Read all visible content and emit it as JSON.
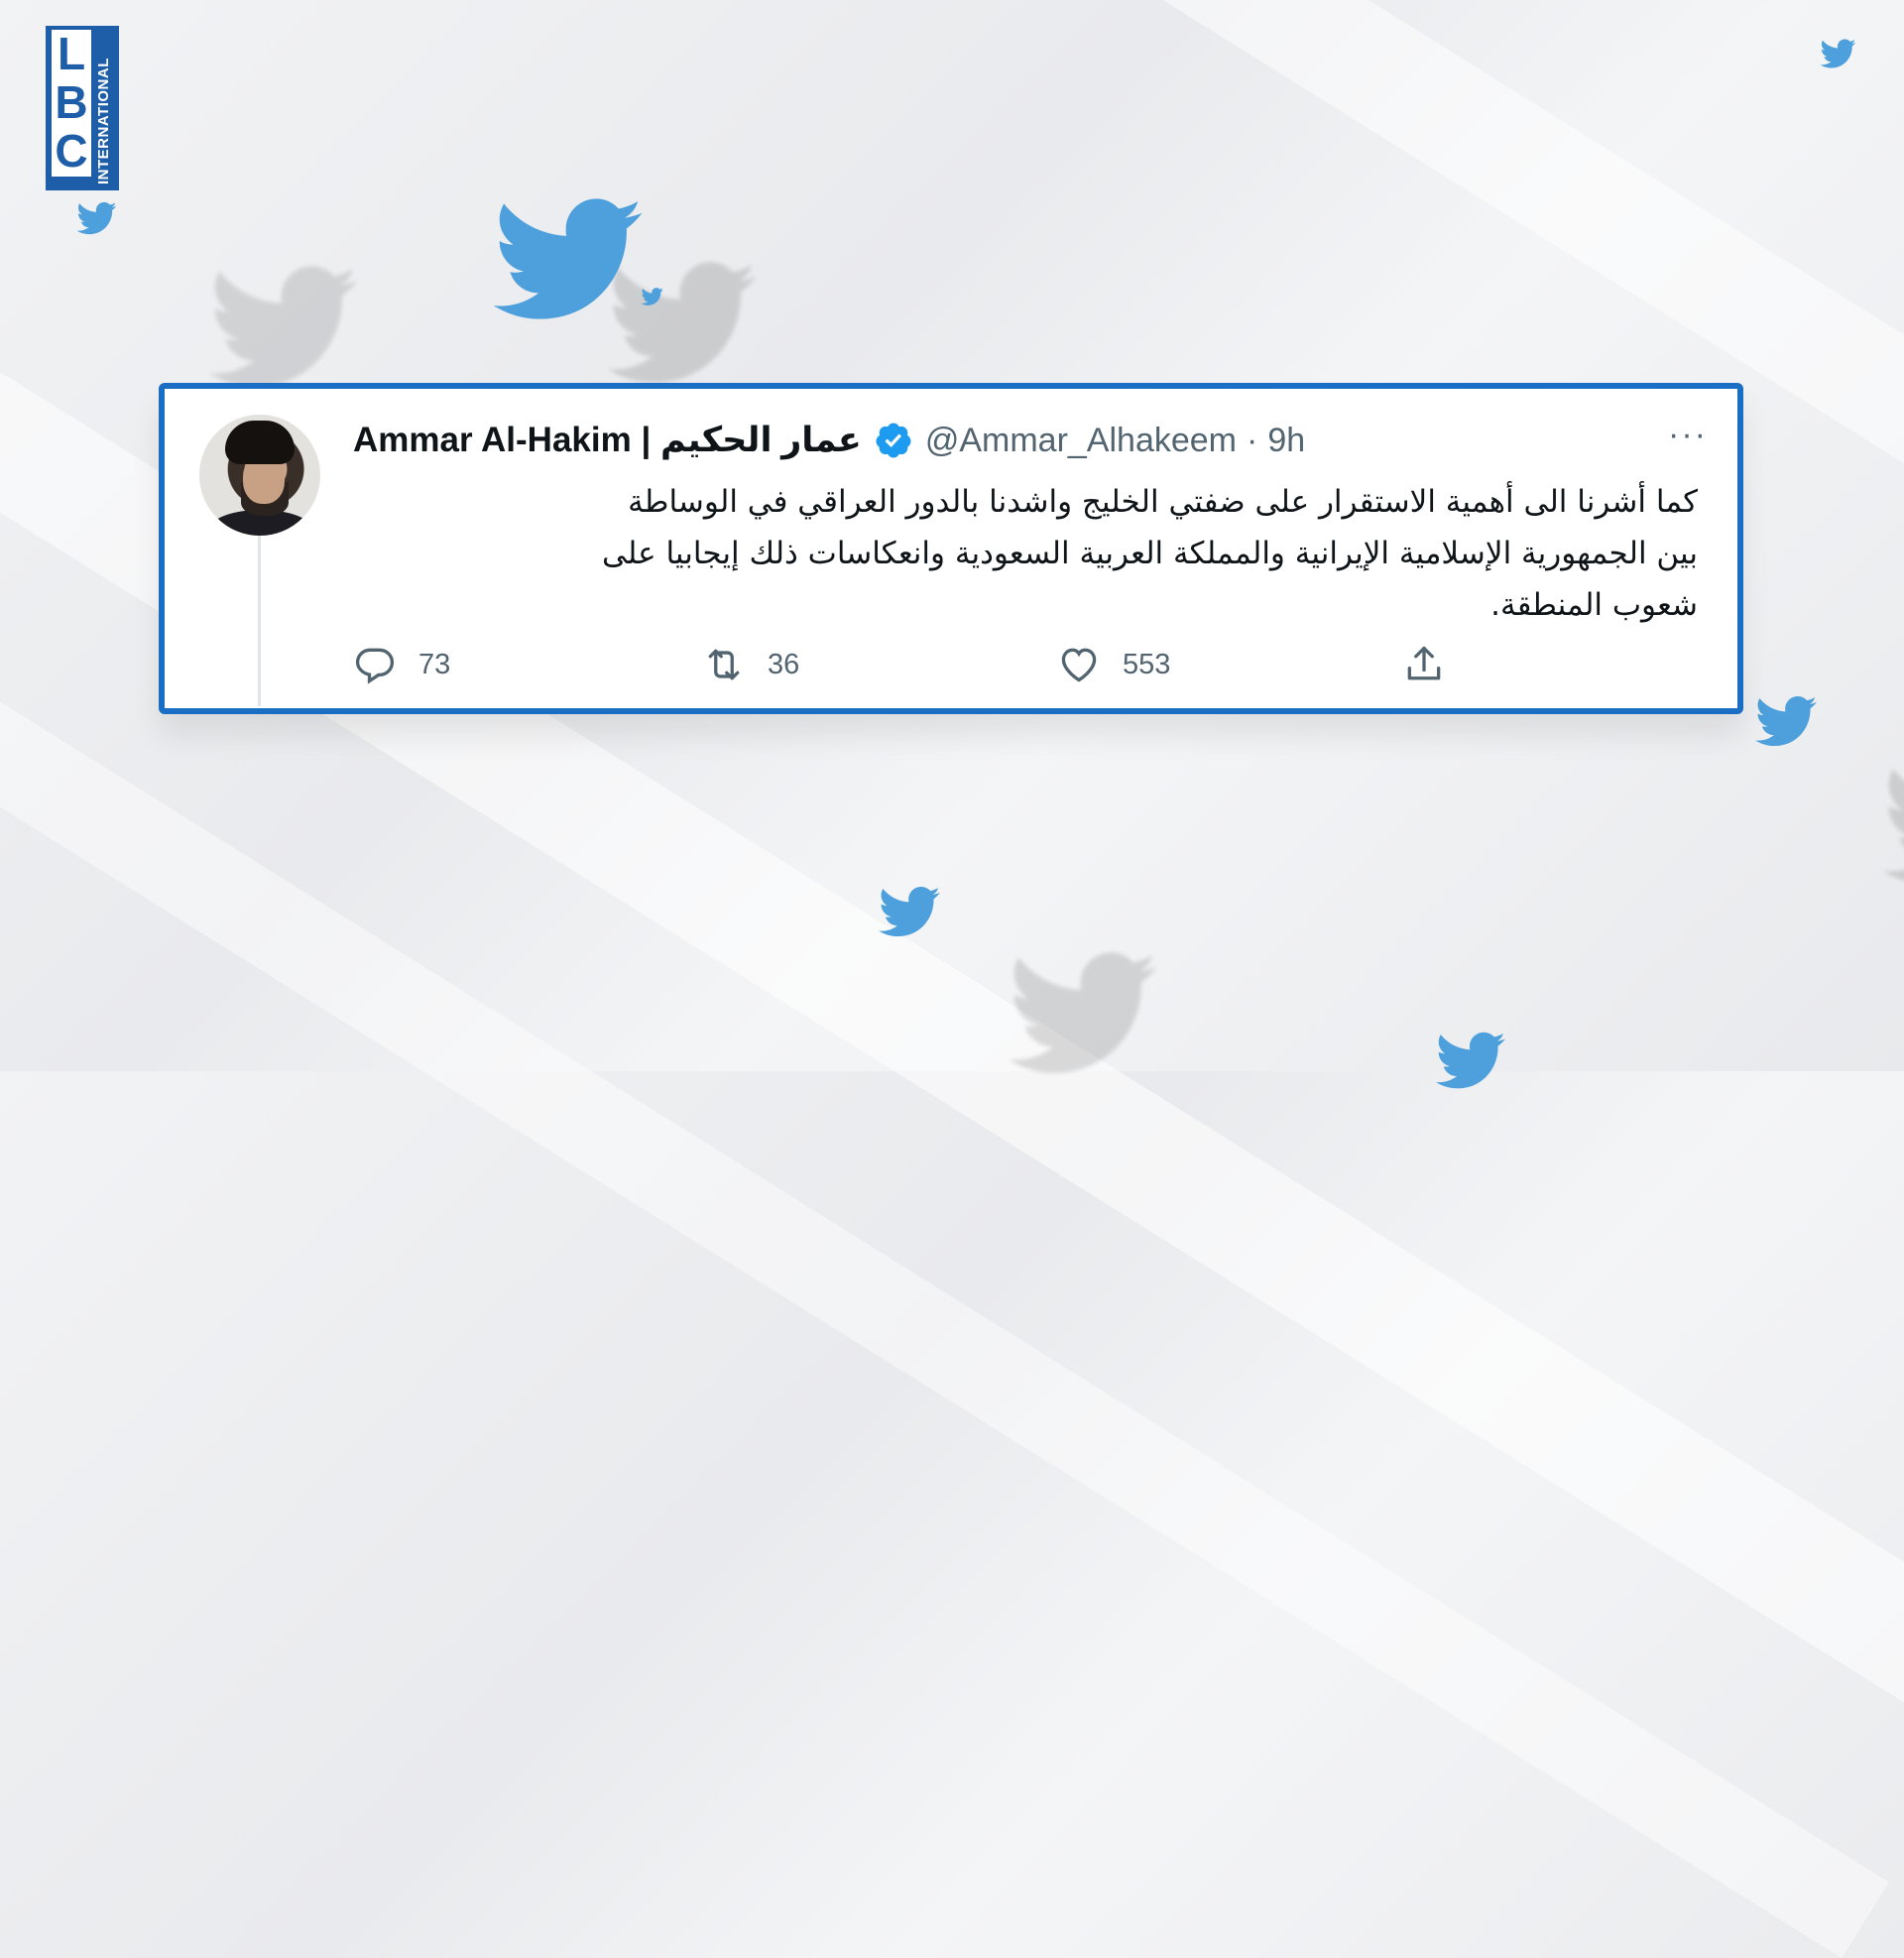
{
  "logo": {
    "letters": [
      "L",
      "B",
      "C"
    ],
    "subtitle": "INTERNATIONAL"
  },
  "tweet": {
    "display_name": "Ammar Al-Hakim | عمار الحكيم",
    "handle": "@Ammar_Alhakeem",
    "separator": "·",
    "time": "9h",
    "more": "···",
    "text_lines": [
      "كما أشرنا الى أهمية الاستقرار على ضفتي الخليج واشدنا بالدور العراقي في الوساطة",
      "بين الجمهورية الإسلامية الإيرانية والمملكة العربية السعودية وانعكاسات ذلك إيجابيا على",
      "شعوب المنطقة."
    ],
    "stats": {
      "replies": "73",
      "retweets": "36",
      "likes": "553"
    }
  },
  "colors": {
    "twitter_blue": "#4da0db",
    "frame_blue": "#1a6fc4",
    "verified": "#1d9bf0",
    "logo_blue": "#1e5ea8"
  },
  "icons": [
    "twitter-bird-icon",
    "verified-badge-icon",
    "reply-icon",
    "retweet-icon",
    "like-icon",
    "share-icon",
    "more-icon"
  ]
}
